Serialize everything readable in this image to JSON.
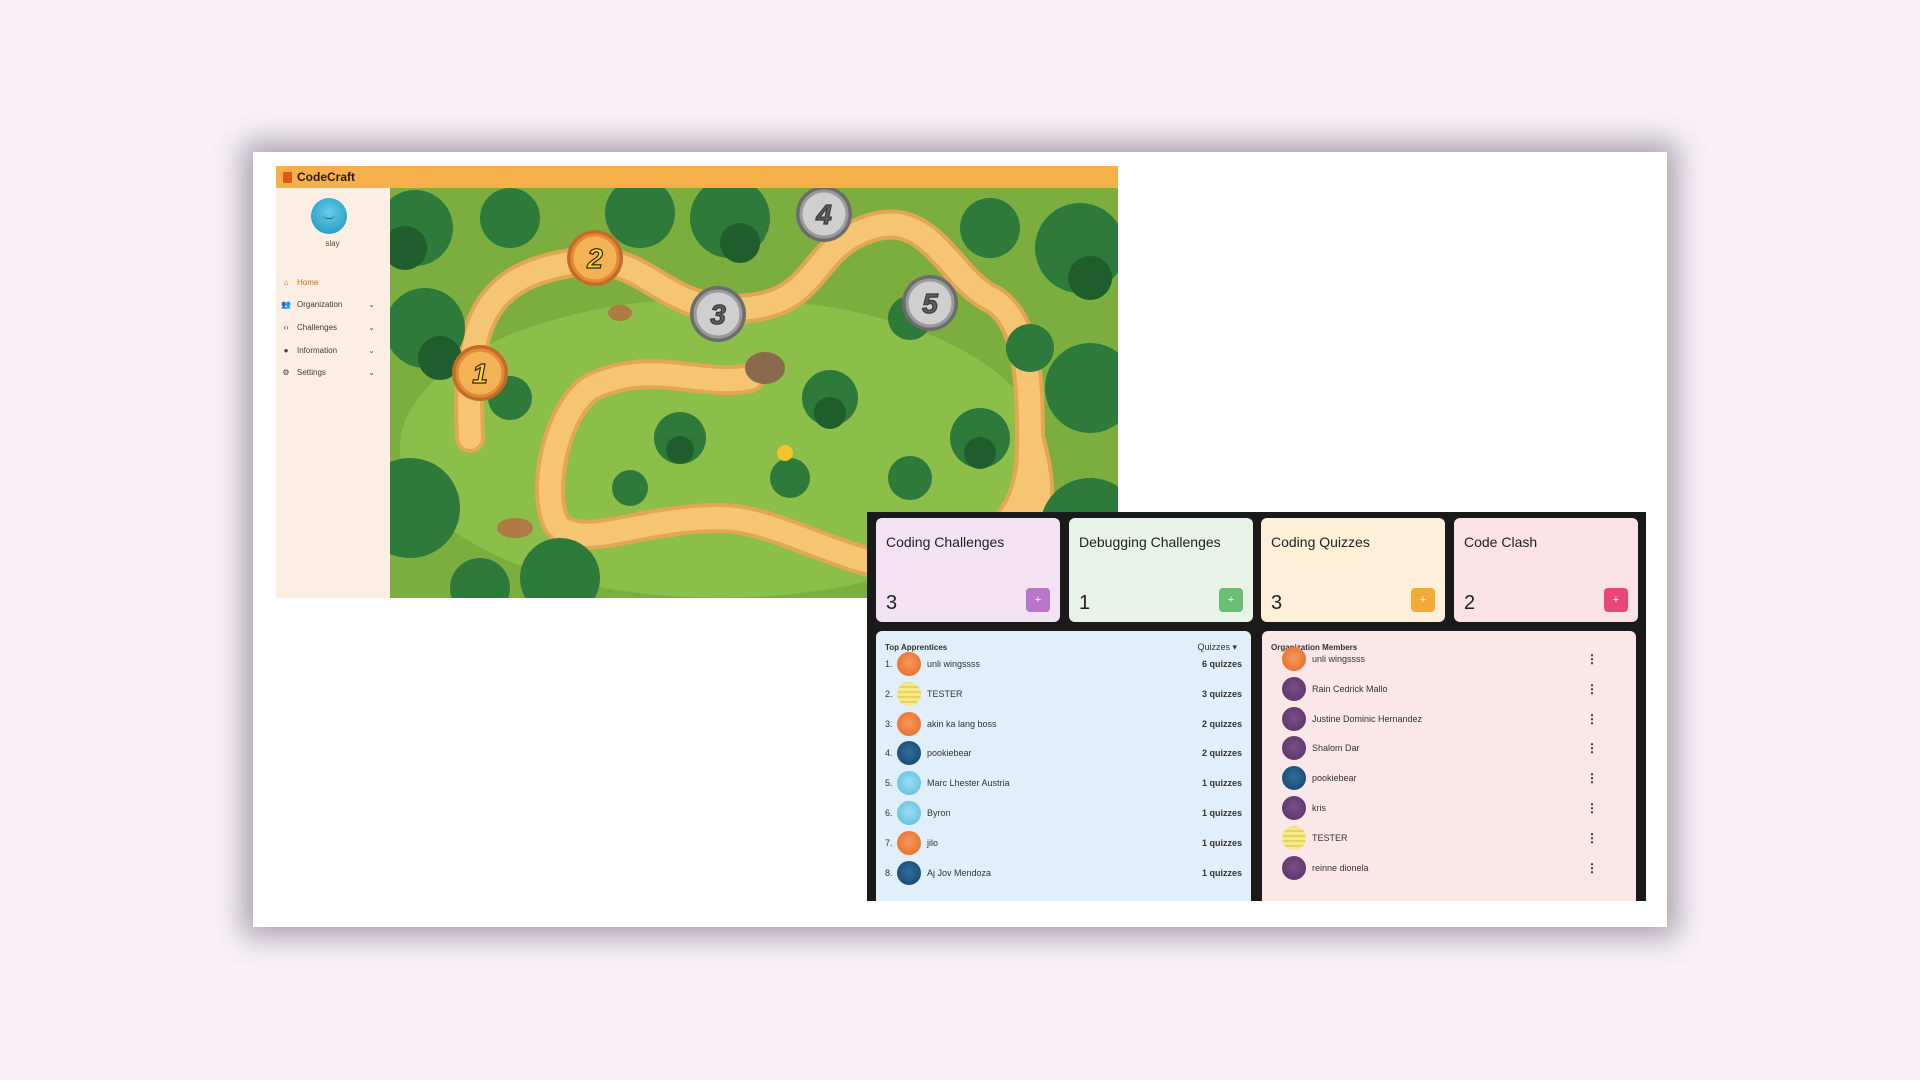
{
  "app": {
    "title": "CodeCraft",
    "user_name": "slay",
    "nav": [
      {
        "label": "Home",
        "icon": "home-icon",
        "glyph": "⌂",
        "has_children": false,
        "active": true
      },
      {
        "label": "Organization",
        "icon": "people-icon",
        "glyph": "👥",
        "has_children": true,
        "active": false
      },
      {
        "label": "Challenges",
        "icon": "code-icon",
        "glyph": "‹›",
        "has_children": true,
        "active": false
      },
      {
        "label": "Information",
        "icon": "info-icon",
        "glyph": "●",
        "has_children": true,
        "active": false
      },
      {
        "label": "Settings",
        "icon": "gear-icon",
        "glyph": "⚙",
        "has_children": true,
        "active": false
      }
    ],
    "levels": [
      {
        "number": "1",
        "state": "unlocked"
      },
      {
        "number": "2",
        "state": "unlocked"
      },
      {
        "number": "3",
        "state": "locked"
      },
      {
        "number": "4",
        "state": "locked"
      },
      {
        "number": "5",
        "state": "locked"
      }
    ]
  },
  "dashboard": {
    "cards": [
      {
        "title": "Coding Challenges",
        "count": "3",
        "bg": "#f2e2f3",
        "accent": "#b776c8",
        "plus": "+"
      },
      {
        "title": "Debugging Challenges",
        "count": "1",
        "bg": "#e6f3e6",
        "accent": "#6cbe74",
        "plus": "+"
      },
      {
        "title": "Coding Quizzes",
        "count": "3",
        "bg": "#fdefd8",
        "accent": "#f4aa36",
        "plus": "+"
      },
      {
        "title": "Code Clash",
        "count": "2",
        "bg": "#fbe2e6",
        "accent": "#e9467a",
        "plus": "+"
      }
    ],
    "apprentices": {
      "title": "Top Apprentices",
      "filter": "Quizzes",
      "rows": [
        {
          "rank": "1.",
          "name": "unli wingssss",
          "count": "6 quizzes",
          "avatar": "orange"
        },
        {
          "rank": "2.",
          "name": "TESTER",
          "count": "3 quizzes",
          "avatar": "note"
        },
        {
          "rank": "3.",
          "name": "akin ka lang boss",
          "count": "2 quizzes",
          "avatar": "orange"
        },
        {
          "rank": "4.",
          "name": "pookiebear",
          "count": "2 quizzes",
          "avatar": "navy"
        },
        {
          "rank": "5.",
          "name": "Marc Lhester Austria",
          "count": "1 quizzes",
          "avatar": "sky"
        },
        {
          "rank": "6.",
          "name": "Byron",
          "count": "1 quizzes",
          "avatar": "sky"
        },
        {
          "rank": "7.",
          "name": "jilo",
          "count": "1 quizzes",
          "avatar": "orange"
        },
        {
          "rank": "8.",
          "name": "Aj Jov Mendoza",
          "count": "1 quizzes",
          "avatar": "navy"
        }
      ]
    },
    "members": {
      "title": "Organization Members",
      "rows": [
        {
          "name": "unli wingssss",
          "avatar": "orange"
        },
        {
          "name": "Rain Cedrick Mallo",
          "avatar": "purple"
        },
        {
          "name": "Justine Dominic Hernandez",
          "avatar": "purple"
        },
        {
          "name": "Shalom Dar",
          "avatar": "purple"
        },
        {
          "name": "pookiebear",
          "avatar": "navy"
        },
        {
          "name": "kris",
          "avatar": "purple"
        },
        {
          "name": "TESTER",
          "avatar": "note"
        },
        {
          "name": "reinne dionela",
          "avatar": "purple"
        }
      ]
    }
  }
}
